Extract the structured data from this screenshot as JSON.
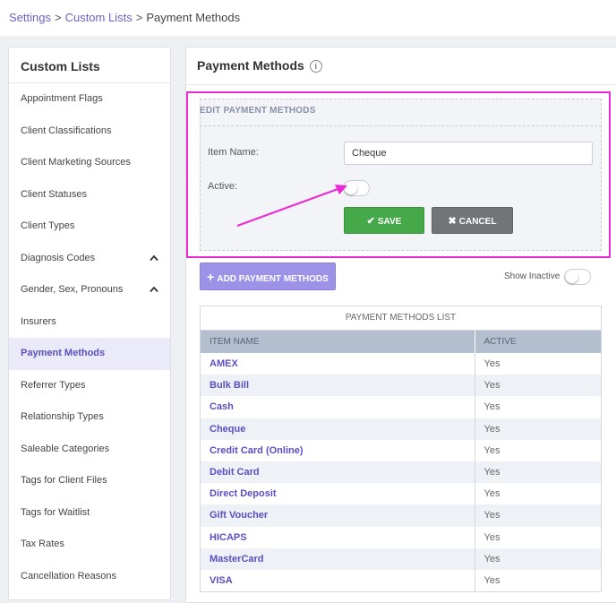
{
  "breadcrumb": {
    "settings": "Settings",
    "sep": ">",
    "custom_lists": "Custom Lists",
    "current": "Payment Methods"
  },
  "sidebar": {
    "title": "Custom Lists",
    "items": [
      {
        "label": "Appointment Flags"
      },
      {
        "label": "Client Classifications"
      },
      {
        "label": "Client Marketing Sources"
      },
      {
        "label": "Client Statuses"
      },
      {
        "label": "Client Types"
      },
      {
        "label": "Diagnosis Codes",
        "icon": "chevron-up-icon"
      },
      {
        "label": "Gender, Sex, Pronouns",
        "icon": "chevron-up-icon"
      },
      {
        "label": "Insurers"
      },
      {
        "label": "Payment Methods",
        "active": true
      },
      {
        "label": "Referrer Types"
      },
      {
        "label": "Relationship Types"
      },
      {
        "label": "Saleable Categories"
      },
      {
        "label": "Tags for Client Files"
      },
      {
        "label": "Tags for Waitlist"
      },
      {
        "label": "Tax Rates"
      },
      {
        "label": "Cancellation Reasons"
      }
    ]
  },
  "main": {
    "title": "Payment Methods",
    "info_icon": "i",
    "edit_panel": {
      "title": "EDIT PAYMENT METHODS",
      "item_name_label": "Item Name:",
      "item_name_value": "Cheque",
      "active_label": "Active:",
      "active_value": false,
      "save_label": "SAVE",
      "cancel_label": "CANCEL"
    },
    "add_button_label": "ADD PAYMENT METHODS",
    "show_inactive_label": "Show Inactive",
    "show_inactive_value": false,
    "list": {
      "title": "PAYMENT METHODS LIST",
      "columns": [
        "ITEM NAME",
        "ACTIVE"
      ],
      "rows": [
        {
          "name": "AMEX",
          "active": "Yes"
        },
        {
          "name": "Bulk Bill",
          "active": "Yes"
        },
        {
          "name": "Cash",
          "active": "Yes"
        },
        {
          "name": "Cheque",
          "active": "Yes"
        },
        {
          "name": "Credit Card (Online)",
          "active": "Yes"
        },
        {
          "name": "Debit Card",
          "active": "Yes"
        },
        {
          "name": "Direct Deposit",
          "active": "Yes"
        },
        {
          "name": "Gift Voucher",
          "active": "Yes"
        },
        {
          "name": "HICAPS",
          "active": "Yes"
        },
        {
          "name": "MasterCard",
          "active": "Yes"
        },
        {
          "name": "VISA",
          "active": "Yes"
        }
      ]
    }
  },
  "colors": {
    "accent": "#5a4fc0",
    "highlight": "#e82bd4",
    "save": "#45a849",
    "cancel": "#727478",
    "add": "#9c93e8"
  }
}
